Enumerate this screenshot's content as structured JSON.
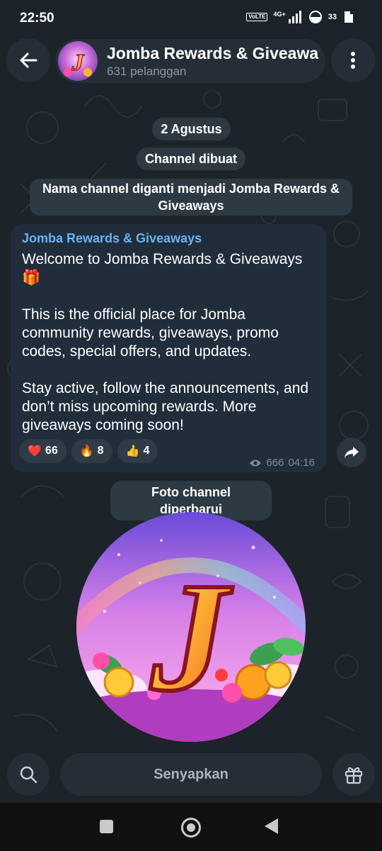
{
  "status_bar": {
    "time": "22:50",
    "network": "4G+",
    "volte": "VoLTE",
    "battery_percent": "33"
  },
  "header": {
    "title": "Jomba Rewards & Giveaways",
    "subtitle": "631 pelanggan",
    "avatar_letter": "J"
  },
  "service_messages": {
    "date": "2 Agustus",
    "created": "Channel dibuat",
    "renamed_line1": "Nama channel diganti menjadi Jomba Rewards &",
    "renamed_line2": "Giveaways",
    "photo_updated": "Foto channel diperbarui"
  },
  "message": {
    "sender": "Jomba Rewards & Giveaways",
    "paragraph1": "Welcome to Jomba Rewards & Giveaways",
    "paragraph1_emoji": "🎁",
    "paragraph2": "This is the official place for Jomba community rewards, giveaways, promo codes, special offers, and updates.",
    "paragraph3": "Stay active, follow the announcements, and don’t miss upcoming rewards. More giveaways coming soon!",
    "reactions": [
      {
        "emoji": "❤️",
        "count": "66"
      },
      {
        "emoji": "🔥",
        "count": "8"
      },
      {
        "emoji": "👍",
        "count": "4"
      }
    ],
    "views": "666",
    "time": "04:16"
  },
  "channel_photo": {
    "letter": "J"
  },
  "bottom_bar": {
    "mute_label": "Senyapkan"
  },
  "colors": {
    "background": "#1c2329",
    "bubble": "#212d3b",
    "pill": "#2e3a43",
    "accent_link": "#6ab2f2",
    "muted_text": "#8e979f"
  },
  "icons": [
    "back-arrow-icon",
    "more-vertical-icon",
    "forward-icon",
    "eye-icon",
    "search-icon",
    "gift-icon",
    "signal-icon",
    "wifi-icon",
    "battery-icon"
  ]
}
